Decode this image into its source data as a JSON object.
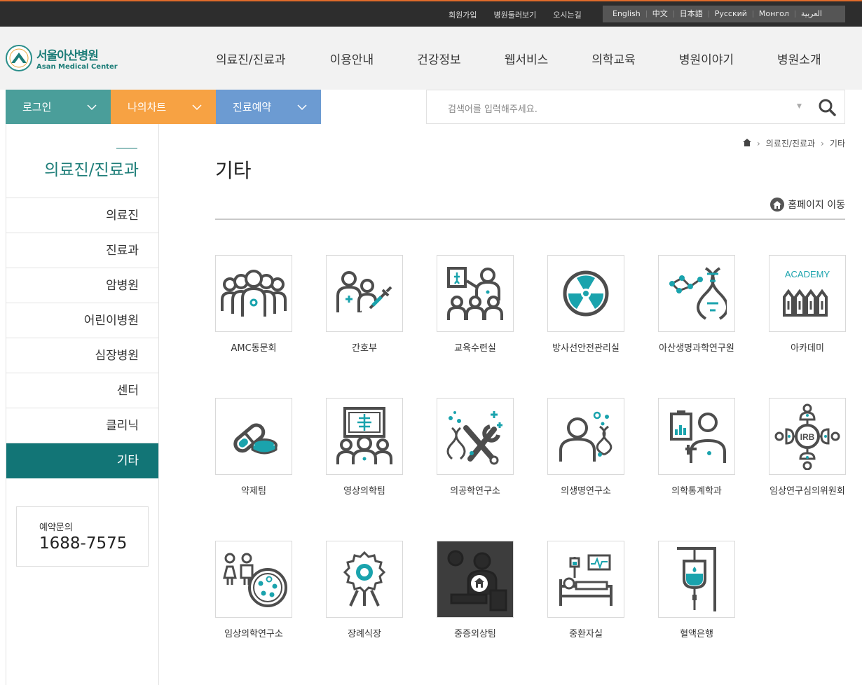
{
  "util_links": [
    "회원가입",
    "병원둘러보기",
    "오시는길"
  ],
  "languages": [
    "English",
    "中文",
    "日本語",
    "Русский",
    "Монгол",
    "العربية"
  ],
  "logo": {
    "ko": "서울아산병원",
    "en": "Asan Medical Center"
  },
  "gnb": [
    "의료진/진료과",
    "이용안내",
    "건강정보",
    "웹서비스",
    "의학교육",
    "병원이야기",
    "병원소개"
  ],
  "quick": [
    {
      "label": "로그인",
      "color": "#4a9e9a"
    },
    {
      "label": "나의차트",
      "color": "#f7a243"
    },
    {
      "label": "진료예약",
      "color": "#6c9bd2"
    }
  ],
  "search": {
    "placeholder": "검색어를 입력해주세요."
  },
  "lnb": {
    "title": "의료진/진료과",
    "items": [
      "의료진",
      "진료과",
      "암병원",
      "어린이병원",
      "심장병원",
      "센터",
      "클리닉",
      "기타"
    ],
    "active": "기타"
  },
  "contact": {
    "label": "예약문의",
    "number": "1688-7575"
  },
  "breadcrumb": [
    "의료진/진료과",
    "기타"
  ],
  "page_title": "기타",
  "homepage_link": "홈페이지 이동",
  "tiles": [
    {
      "label": "AMC동문회",
      "icon": "alumni-group-icon"
    },
    {
      "label": "간호부",
      "icon": "nurse-icon"
    },
    {
      "label": "교육수련실",
      "icon": "education-icon"
    },
    {
      "label": "방사선안전관리실",
      "icon": "radiation-icon"
    },
    {
      "label": "아산생명과학연구원",
      "icon": "dna-research-icon"
    },
    {
      "label": "아카데미",
      "icon": "academy-icon",
      "badge": "ACADEMY"
    },
    {
      "label": "약제팀",
      "icon": "pill-icon"
    },
    {
      "label": "영상의학팀",
      "icon": "xray-icon"
    },
    {
      "label": "의공학연구소",
      "icon": "tools-icon"
    },
    {
      "label": "의생명연구소",
      "icon": "biomedical-icon"
    },
    {
      "label": "의학통계학과",
      "icon": "statistics-icon"
    },
    {
      "label": "임상연구심의위원회",
      "icon": "irb-icon",
      "badge": "IRB"
    },
    {
      "label": "임상의학연구소",
      "icon": "clinical-research-icon"
    },
    {
      "label": "장례식장",
      "icon": "funeral-wreath-icon"
    },
    {
      "label": "중증외상팀",
      "icon": "trauma-icon",
      "hovered": true
    },
    {
      "label": "중환자실",
      "icon": "icu-bed-icon"
    },
    {
      "label": "혈액은행",
      "icon": "blood-bag-icon"
    }
  ],
  "colors": {
    "teal": "#127576",
    "accent": "#1aa3ad",
    "icon_gray": "#4d4d4d"
  }
}
